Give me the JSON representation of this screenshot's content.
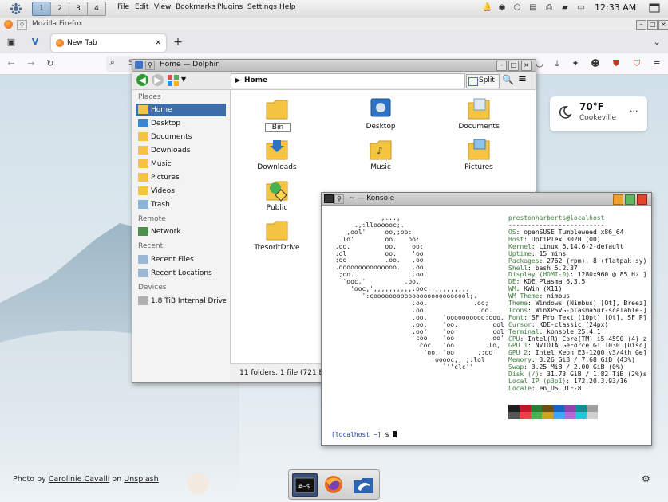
{
  "panel": {
    "desktops": [
      "1",
      "2",
      "3",
      "4"
    ],
    "active_desktop": 1,
    "menu": [
      "File",
      "Edit",
      "View",
      "Bookmarks",
      "Plugins",
      "Settings",
      "Help"
    ],
    "clock": "12:33 AM",
    "tray_icons": [
      "bell-icon",
      "shield-icon",
      "package-icon",
      "file-icon",
      "printer-icon",
      "clipboard-icon",
      "monitor-icon",
      "volume-icon"
    ]
  },
  "firefox": {
    "window_title": "Mozilla Firefox",
    "tab_label": "New Tab",
    "url_prefix": "S",
    "weather": {
      "temp": "70°F",
      "city": "Cookeville",
      "more": "···"
    }
  },
  "dolphin": {
    "title": "Home — Dolphin",
    "breadcrumb": "Home",
    "split_label": "Split",
    "status": "11 folders, 1 file (721 B)",
    "sections": {
      "places": "Places",
      "remote": "Remote",
      "recent": "Recent",
      "devices": "Devices"
    },
    "places": [
      "Home",
      "Desktop",
      "Documents",
      "Downloads",
      "Music",
      "Pictures",
      "Videos",
      "Trash"
    ],
    "remote": [
      "Network"
    ],
    "recent": [
      "Recent Files",
      "Recent Locations"
    ],
    "devices": [
      "1.8 TiB Internal Drive ..."
    ],
    "files": [
      "Bin",
      "Desktop",
      "Documents",
      "Downloads",
      "Music",
      "Pictures",
      "Public",
      "",
      "",
      "TresoritDrive"
    ]
  },
  "konsole": {
    "title": "~ — Konsole",
    "ascii": [
      "             ,...,",
      "      .,:lloooooc;.",
      "    ,ool'     oo,;oo:",
      "  .lo'        oo.   oo:",
      " .oo.         oo.    oo:",
      " :ol          oo.    'oo",
      " :oo          .oo.   .oo",
      " .ooooooooooooooo.   .oo.",
      "  ;oo.               .oo.",
      "   'ooc,'          .oo.",
      "     'ooc,',,,,,,,,,,:ooc,,,,,,,,,,,",
      "        ':cooooooooooooooooooooooool;.",
      "                     .oo.            .oo;",
      "                     .oo.             .oo.",
      "                     .oo.    'oooooooooo:ooo.",
      "                     .oo.    'oo.         col",
      "                     .oo'    'oo          col",
      "                      coo    'oo          oo'",
      "                       coc   'oo        .lo,",
      "                        'oo, 'oo      .:oo",
      "                          'ooooc,, ,:lol",
      "                             `''clc''"
    ],
    "user_host": "prestonharberts@localhost",
    "separator": "-------------------------",
    "info": [
      {
        "k": "OS",
        "v": "openSUSE Tumbleweed x86_64"
      },
      {
        "k": "Host",
        "v": "OptiPlex 3020 (00)"
      },
      {
        "k": "Kernel",
        "v": "Linux 6.14.6-2-default"
      },
      {
        "k": "Uptime",
        "v": "15 mins"
      },
      {
        "k": "Packages",
        "v": "2762 (rpm), 8 (flatpak-sy)"
      },
      {
        "k": "Shell",
        "v": "bash 5.2.37"
      },
      {
        "k": "Display (HDMI-0)",
        "v": "1280x960 @ 85 Hz ]"
      },
      {
        "k": "DE",
        "v": "KDE Plasma 6.3.5"
      },
      {
        "k": "WM",
        "v": "KWin (X11)"
      },
      {
        "k": "WM Theme",
        "v": "nimbus"
      },
      {
        "k": "Theme",
        "v": "Windows (Nimbus) [Qt], Breez]"
      },
      {
        "k": "Icons",
        "v": "WinXPSVG-plasma5ur-scalable-]"
      },
      {
        "k": "Font",
        "v": "SF Pro Text (10pt) [Qt], SF P]"
      },
      {
        "k": "Cursor",
        "v": "KDE-classic (24px)"
      },
      {
        "k": "Terminal",
        "v": "konsole 25.4.1"
      },
      {
        "k": "CPU",
        "v": "Intel(R) Core(TM) i5-4590 (4) z"
      },
      {
        "k": "GPU 1",
        "v": "NVIDIA GeForce GT 1030 [Disc]"
      },
      {
        "k": "GPU 2",
        "v": "Intel Xeon E3-1200 v3/4th Ge]"
      },
      {
        "k": "Memory",
        "v": "3.26 GiB / 7.68 GiB (43%)"
      },
      {
        "k": "Swap",
        "v": "3.25 MiB / 2.00 GiB (0%)"
      },
      {
        "k": "Disk (/)",
        "v": "31.73 GiB / 1.82 TiB (2%)s"
      },
      {
        "k": "Local IP (p3p1)",
        "v": "172.20.3.93/16"
      },
      {
        "k": "Locale",
        "v": "en_US.UTF-8"
      }
    ],
    "palette": [
      "#1e1e1e",
      "#c0152b",
      "#2e7d32",
      "#6b4e16",
      "#1565c0",
      "#8e44ad",
      "#138d90",
      "#9e9e9e",
      "#555555",
      "#ef3e4a",
      "#4caf50",
      "#c9a227",
      "#42a5f5",
      "#b36ad8",
      "#26c6da",
      "#cfcfcf"
    ],
    "prompt_host": "localhost ~",
    "prompt_tail": " $ "
  },
  "credit": {
    "prefix": "Photo by ",
    "author": "Carolinie Cavalli",
    "mid": " on ",
    "site": "Unsplash"
  },
  "dock_icons": [
    "konsole-icon",
    "firefox-icon",
    "dolphin-icon"
  ]
}
